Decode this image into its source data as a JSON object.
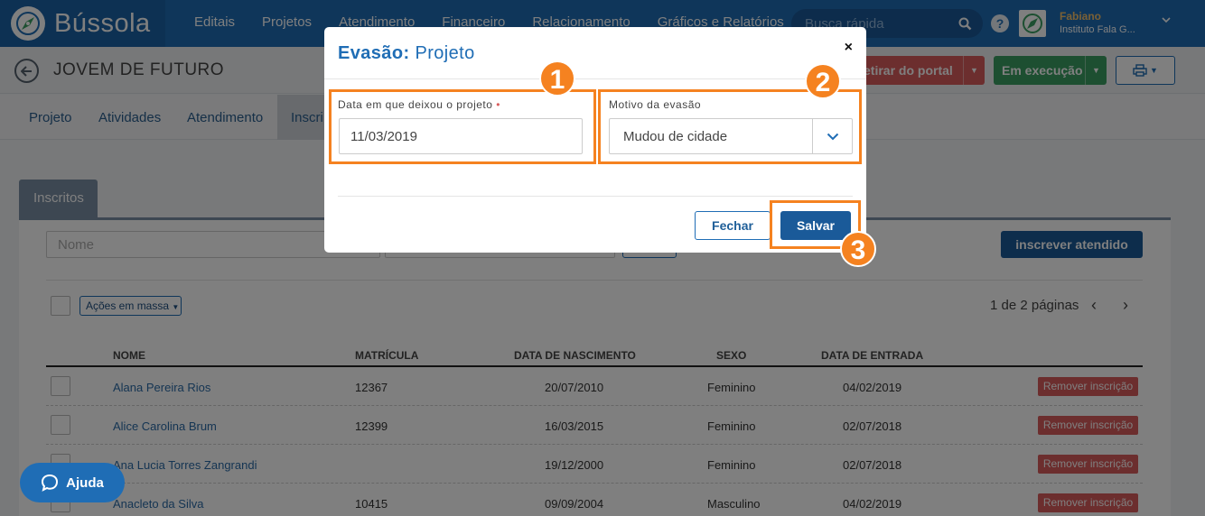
{
  "app": {
    "logo_text": "Bússola"
  },
  "nav": {
    "items": [
      "Editais",
      "Projetos",
      "Atendimento",
      "Financeiro",
      "Relacionamento",
      "Gráficos e Relatórios"
    ]
  },
  "search": {
    "placeholder": "Busca rápida"
  },
  "user": {
    "name": "Fabiano",
    "org": "Instituto Fala G..."
  },
  "page": {
    "title": "JOVEM DE FUTURO",
    "retirar_label": "etirar do portal",
    "status_label": "Em execução"
  },
  "tabs": [
    "Projeto",
    "Atividades",
    "Atendimento",
    "Inscri"
  ],
  "subtab": "Inscritos",
  "filters": {
    "nome_placeholder": "Nome",
    "inscrever_label": "inscrever atendido"
  },
  "bulk": {
    "acoes_label": "Ações em massa"
  },
  "pagination": {
    "text": "1 de 2 páginas",
    "prev": "‹",
    "next": "›"
  },
  "table": {
    "headers": [
      "NOME",
      "MATRÍCULA",
      "DATA DE NASCIMENTO",
      "SEXO",
      "DATA DE ENTRADA"
    ],
    "remove_label": "Remover inscrição",
    "rows": [
      {
        "nome": "Alana Pereira Rios",
        "matricula": "12367",
        "nascimento": "20/07/2010",
        "sexo": "Feminino",
        "entrada": "04/02/2019"
      },
      {
        "nome": "Alice Carolina Brum",
        "matricula": "12399",
        "nascimento": "16/03/2015",
        "sexo": "Feminino",
        "entrada": "02/07/2018"
      },
      {
        "nome": "Ana Lucia Torres Zangrandi",
        "matricula": "",
        "nascimento": "19/12/2000",
        "sexo": "Feminino",
        "entrada": "02/07/2018"
      },
      {
        "nome": "Anacleto da Silva",
        "matricula": "10415",
        "nascimento": "09/09/2004",
        "sexo": "Masculino",
        "entrada": "04/02/2019"
      }
    ]
  },
  "modal": {
    "title_bold": "Evasão:",
    "title_rest": " Projeto",
    "close": "×",
    "date_label": "Data em que deixou o projeto",
    "required_mark": "•",
    "date_value": "11/03/2019",
    "motivo_label": "Motivo da evasão",
    "motivo_value": "Mudou de cidade",
    "fechar_label": "Fechar",
    "salvar_label": "Salvar"
  },
  "annotations": [
    "1",
    "2",
    "3"
  ],
  "help": {
    "label": "Ajuda"
  },
  "colors": {
    "primary": "#1f6db5",
    "annotation": "#f58220",
    "danger": "#d95c5c",
    "success": "#3a9f62"
  }
}
